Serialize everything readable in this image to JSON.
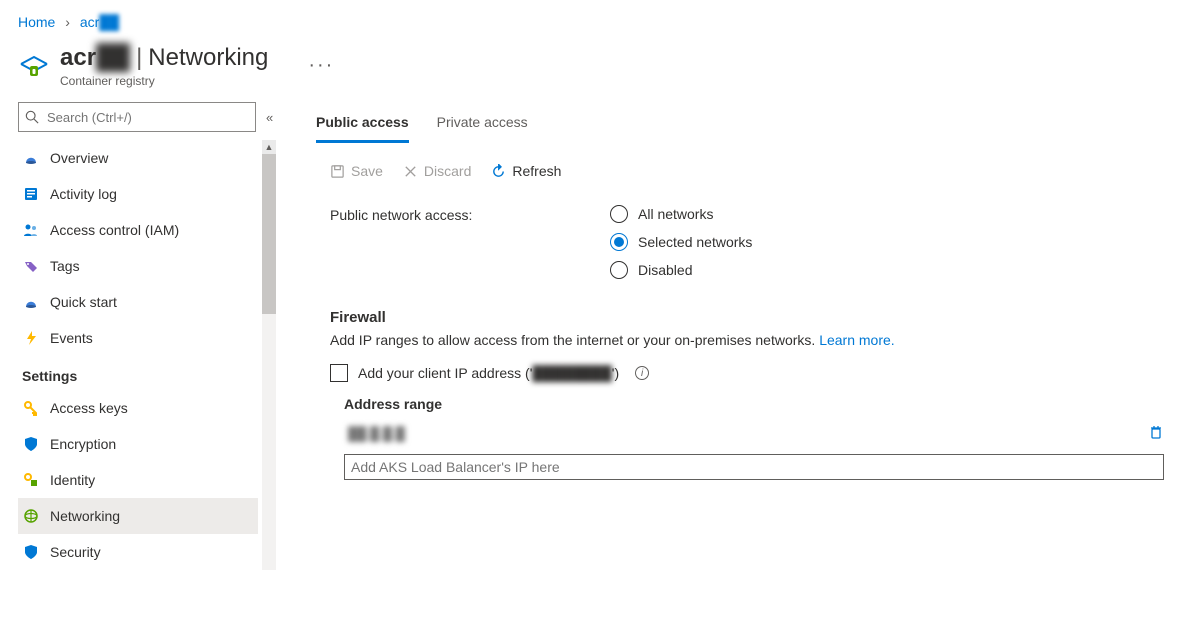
{
  "breadcrumb": {
    "home": "Home",
    "resource_prefix": "acr",
    "resource_suffix_masked": "██"
  },
  "header": {
    "name_prefix": "acr",
    "name_suffix_masked": "██",
    "section": "Networking",
    "subtitle": "Container registry",
    "more_aria": "More"
  },
  "search": {
    "placeholder": "Search (Ctrl+/)"
  },
  "sidebar": {
    "top_items": [
      {
        "key": "overview",
        "label": "Overview"
      },
      {
        "key": "activity-log",
        "label": "Activity log"
      },
      {
        "key": "iam",
        "label": "Access control (IAM)"
      },
      {
        "key": "tags",
        "label": "Tags"
      },
      {
        "key": "quick-start",
        "label": "Quick start"
      },
      {
        "key": "events",
        "label": "Events"
      }
    ],
    "settings_header": "Settings",
    "settings_items": [
      {
        "key": "access-keys",
        "label": "Access keys"
      },
      {
        "key": "encryption",
        "label": "Encryption"
      },
      {
        "key": "identity",
        "label": "Identity"
      },
      {
        "key": "networking",
        "label": "Networking"
      },
      {
        "key": "security",
        "label": "Security"
      }
    ],
    "active_key": "networking"
  },
  "tabs": {
    "items": [
      {
        "key": "public",
        "label": "Public access"
      },
      {
        "key": "private",
        "label": "Private access"
      }
    ],
    "active_key": "public"
  },
  "toolbar": {
    "save": "Save",
    "discard": "Discard",
    "refresh": "Refresh"
  },
  "form": {
    "public_access_label": "Public network access:",
    "radios": [
      {
        "key": "all",
        "label": "All networks"
      },
      {
        "key": "selected",
        "label": "Selected networks"
      },
      {
        "key": "disabled",
        "label": "Disabled"
      }
    ],
    "selected_radio": "selected"
  },
  "firewall": {
    "heading": "Firewall",
    "desc_pre": "Add IP ranges to allow access from the internet or your on-premises networks. ",
    "learn_more": "Learn more.",
    "add_client_ip_pre": "Add your client IP address ('",
    "add_client_ip_masked": "████████",
    "add_client_ip_post": "')",
    "column_header": "Address range",
    "existing_row_masked": "██.█.█.█",
    "new_row_placeholder": "Add AKS Load Balancer's IP here"
  }
}
